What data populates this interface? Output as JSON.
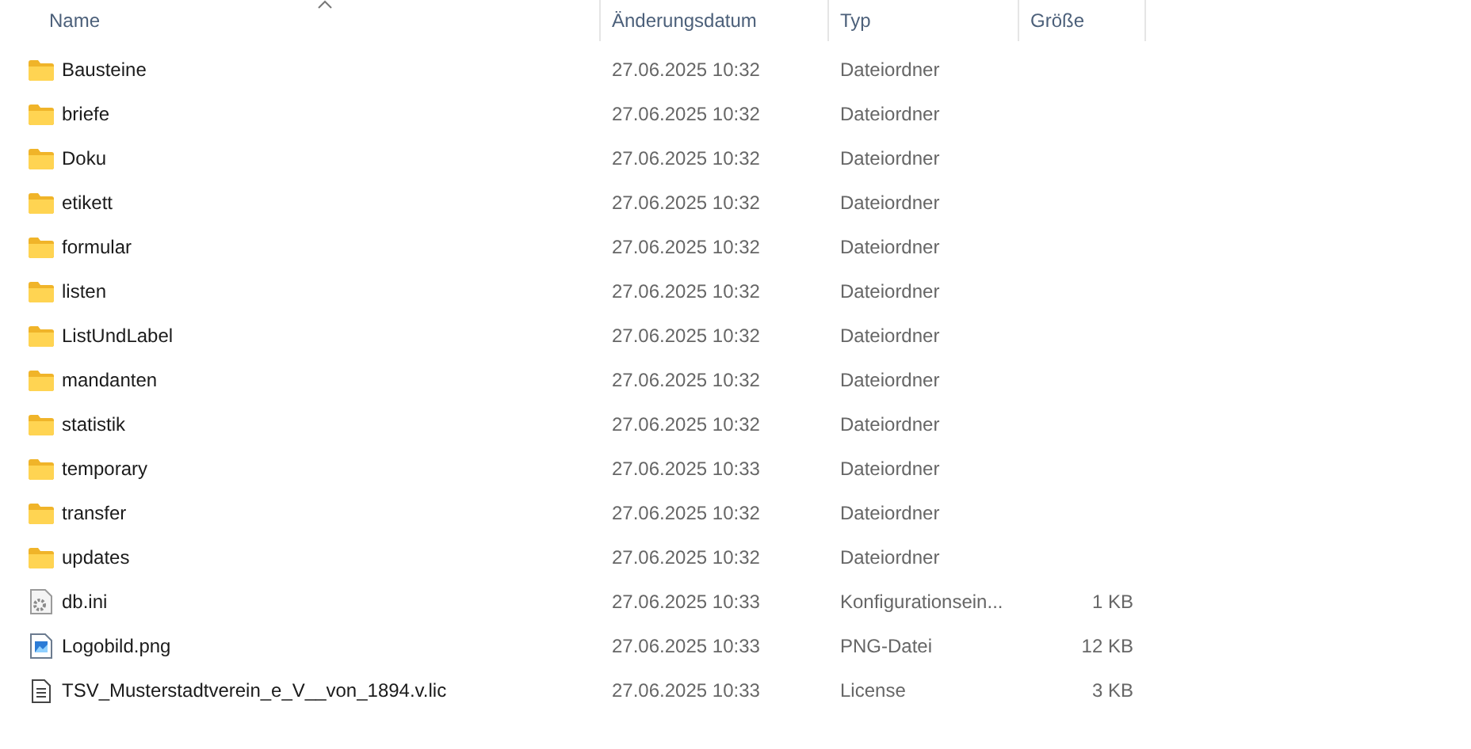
{
  "columns": [
    {
      "label": "Name",
      "sorted": true
    },
    {
      "label": "Änderungsdatum",
      "sorted": false
    },
    {
      "label": "Typ",
      "sorted": false
    },
    {
      "label": "Größe",
      "sorted": false
    }
  ],
  "rows": [
    {
      "kind": "folder",
      "name": "Bausteine",
      "date": "27.06.2025 10:32",
      "type": "Dateiordner"
    },
    {
      "kind": "folder",
      "name": "briefe",
      "date": "27.06.2025 10:32",
      "type": "Dateiordner"
    },
    {
      "kind": "folder",
      "name": "Doku",
      "date": "27.06.2025 10:32",
      "type": "Dateiordner"
    },
    {
      "kind": "folder",
      "name": "etikett",
      "date": "27.06.2025 10:32",
      "type": "Dateiordner"
    },
    {
      "kind": "folder",
      "name": "formular",
      "date": "27.06.2025 10:32",
      "type": "Dateiordner"
    },
    {
      "kind": "folder",
      "name": "listen",
      "date": "27.06.2025 10:32",
      "type": "Dateiordner"
    },
    {
      "kind": "folder",
      "name": "ListUndLabel",
      "date": "27.06.2025 10:32",
      "type": "Dateiordner"
    },
    {
      "kind": "folder",
      "name": "mandanten",
      "date": "27.06.2025 10:32",
      "type": "Dateiordner"
    },
    {
      "kind": "folder",
      "name": "statistik",
      "date": "27.06.2025 10:32",
      "type": "Dateiordner"
    },
    {
      "kind": "folder",
      "name": "temporary",
      "date": "27.06.2025 10:33",
      "type": "Dateiordner"
    },
    {
      "kind": "folder",
      "name": "transfer",
      "date": "27.06.2025 10:32",
      "type": "Dateiordner"
    },
    {
      "kind": "folder",
      "name": "updates",
      "date": "27.06.2025 10:32",
      "type": "Dateiordner"
    },
    {
      "kind": "settings",
      "name": "db.ini",
      "date": "27.06.2025 10:33",
      "type": "Konfigurationsein...",
      "size": "1 KB"
    },
    {
      "kind": "image",
      "name": "Logobild.png",
      "date": "27.06.2025 10:33",
      "type": "PNG-Datei",
      "size": "12 KB"
    },
    {
      "kind": "text",
      "name": "TSV_Musterstadtverein_e_V__von_1894.v.lic",
      "date": "27.06.2025 10:33",
      "type": "License",
      "size": "3 KB"
    }
  ]
}
